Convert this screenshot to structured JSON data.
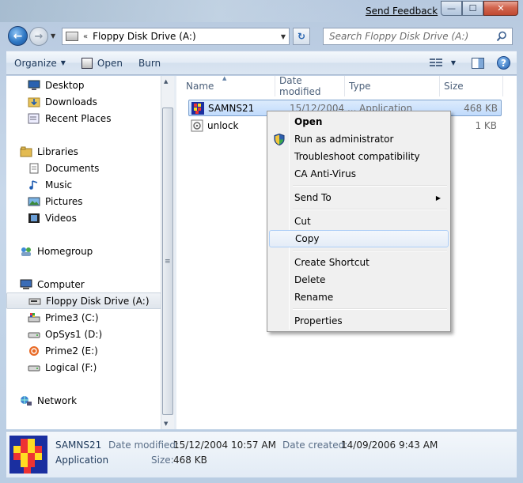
{
  "window": {
    "send_feedback": "Send Feedback",
    "minimize_glyph": "—",
    "maximize_glyph": "☐",
    "close_glyph": "✕"
  },
  "address": {
    "path": "Floppy Disk Drive (A:)",
    "separator": "«"
  },
  "search": {
    "placeholder": "Search Floppy Disk Drive (A:)"
  },
  "toolbar": {
    "organize_label": "Organize",
    "open_label": "Open",
    "burn_label": "Burn"
  },
  "nav": {
    "favorites": [
      {
        "label": "Desktop"
      },
      {
        "label": "Downloads"
      },
      {
        "label": "Recent Places"
      }
    ],
    "libraries_label": "Libraries",
    "libraries": [
      {
        "label": "Documents"
      },
      {
        "label": "Music"
      },
      {
        "label": "Pictures"
      },
      {
        "label": "Videos"
      }
    ],
    "homegroup_label": "Homegroup",
    "computer_label": "Computer",
    "drives": [
      {
        "label": "Floppy Disk Drive (A:)",
        "selected": true
      },
      {
        "label": "Prime3 (C:)"
      },
      {
        "label": "OpSys1 (D:)"
      },
      {
        "label": "Prime2 (E:)"
      },
      {
        "label": "Logical (F:)"
      }
    ],
    "network_label": "Network"
  },
  "columns": {
    "name": "Name",
    "date": "Date modified",
    "type": "Type",
    "size": "Size"
  },
  "files": [
    {
      "name": "SAMNS21",
      "date": "15/12/2004 ...",
      "type": "Application",
      "size": "468 KB",
      "selected": true
    },
    {
      "name": "unlock",
      "date": "",
      "type": "",
      "size": "1 KB",
      "selected": false
    }
  ],
  "context_menu": {
    "items": [
      {
        "label": "Open",
        "bold": true
      },
      {
        "label": "Run as administrator",
        "icon": "shield-icon"
      },
      {
        "label": "Troubleshoot compatibility"
      },
      {
        "label": "CA Anti-Virus"
      },
      {
        "label": "Send To",
        "submenu": true
      },
      {
        "label": "Cut"
      },
      {
        "label": "Copy",
        "hover": true
      },
      {
        "label": "Create Shortcut"
      },
      {
        "label": "Delete"
      },
      {
        "label": "Rename"
      },
      {
        "label": "Properties"
      }
    ]
  },
  "details": {
    "name": "SAMNS21",
    "kind": "Application",
    "date_modified_label": "Date modified:",
    "date_modified": "15/12/2004 10:57 AM",
    "date_created_label": "Date created:",
    "date_created": "14/09/2006 9:43 AM",
    "size_label": "Size:",
    "size": "468 KB"
  },
  "colors": {
    "accent": "#2f78c4",
    "selection": "#c1dbfc",
    "menu_bg": "#f0f0f0"
  }
}
